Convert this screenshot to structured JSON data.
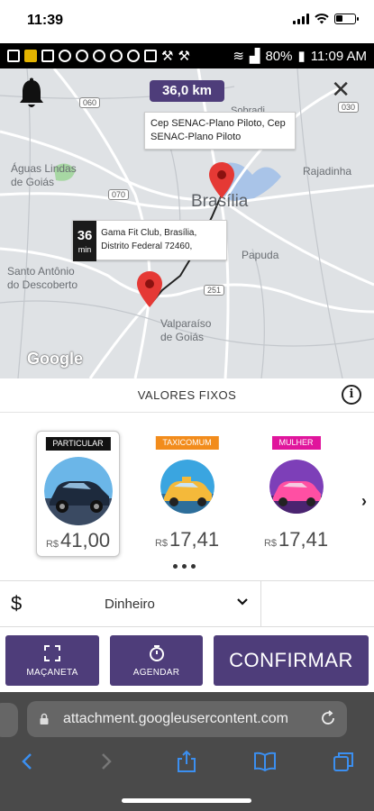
{
  "ios_status": {
    "time": "11:39"
  },
  "android_status": {
    "battery": "80%",
    "time": "11:09 AM"
  },
  "map": {
    "distance": "36,0 km",
    "destination_tooltip": "Cep SENAC-Plano Piloto, Cep SENAC-Plano Piloto",
    "origin_tooltip": "Gama Fit Club, Brasília, Distrito Federal 72460,",
    "eta_value": "36",
    "eta_unit": "min",
    "labels": {
      "aguas_lindas": "Águas Lindas\nde Goiás",
      "brasilia": "Brasília",
      "rajadinha": "Rajadinha",
      "santo_antonio": "Santo Antônio\ndo Descoberto",
      "papuda": "Papuda",
      "valparaiso": "Valparaíso\nde Goiás",
      "sobradinho": "Sobradi..."
    },
    "route_badges": {
      "r060": "060",
      "r070": "070",
      "r251": "251",
      "r030": "030"
    },
    "google": "Google"
  },
  "fares": {
    "title": "VALORES FIXOS",
    "cards": [
      {
        "badge": "PARTICULAR",
        "badge_color": "#111111",
        "currency": "R$",
        "price": "41,00",
        "selected": true
      },
      {
        "badge": "TAXICOMUM",
        "badge_color": "#f28c1c",
        "currency": "R$",
        "price": "17,41",
        "selected": false
      },
      {
        "badge": "MULHER",
        "badge_color": "#e0159c",
        "currency": "R$",
        "price": "17,41",
        "selected": false
      }
    ]
  },
  "payment": {
    "symbol": "$",
    "method": "Dinheiro"
  },
  "actions": {
    "macaneta": "MAÇANETA",
    "agendar": "AGENDAR",
    "confirm": "CONFIRMAR"
  },
  "safari": {
    "url": "attachment.googleusercontent.com"
  },
  "colors": {
    "accent": "#4e3d7a",
    "pin": "#e53935"
  }
}
